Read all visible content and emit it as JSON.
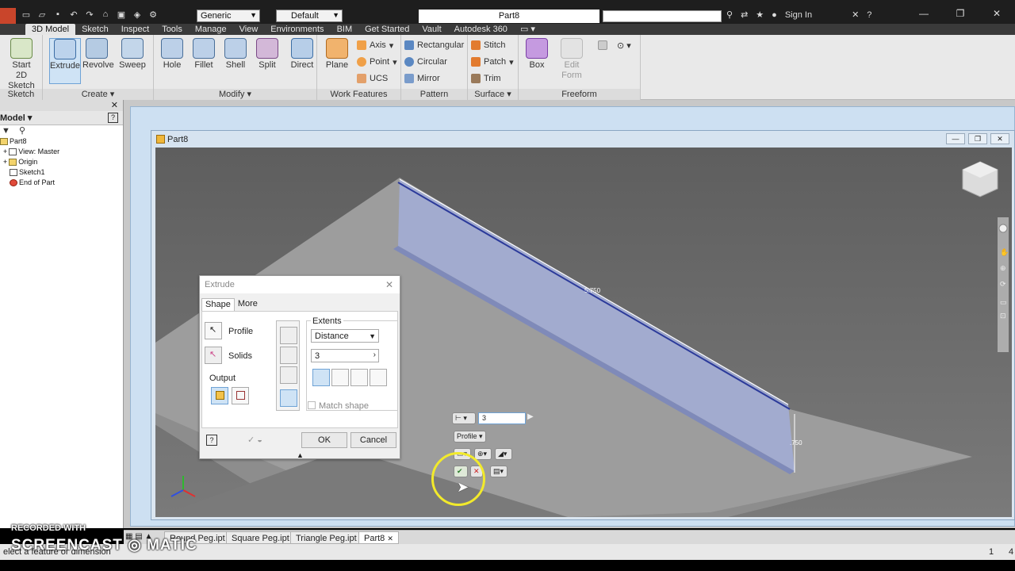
{
  "titlebar": {
    "material": "Generic",
    "appearance": "Default",
    "document_title": "Part8",
    "sign_in": "Sign In"
  },
  "ribbon_tabs": [
    "3D Model",
    "Sketch",
    "Inspect",
    "Tools",
    "Manage",
    "View",
    "Environments",
    "BIM",
    "Get Started",
    "Vault",
    "Autodesk 360"
  ],
  "ribbon": {
    "sketch": {
      "label": "Sketch",
      "start_line1": "Start",
      "start_line2": "2D Sketch"
    },
    "create": {
      "label": "Create",
      "extrude": "Extrude",
      "revolve": "Revolve",
      "sweep": "Sweep"
    },
    "modify": {
      "label": "Modify",
      "hole": "Hole",
      "fillet": "Fillet",
      "shell": "Shell",
      "split": "Split",
      "direct": "Direct"
    },
    "work_features": {
      "label": "Work Features",
      "plane": "Plane",
      "axis": "Axis",
      "point": "Point",
      "ucs": "UCS"
    },
    "pattern": {
      "label": "Pattern",
      "rectangular": "Rectangular",
      "circular": "Circular",
      "mirror": "Mirror"
    },
    "surface": {
      "label": "Surface",
      "stitch": "Stitch",
      "patch": "Patch",
      "trim": "Trim"
    },
    "freeform": {
      "label": "Freeform",
      "box": "Box",
      "edit_line1": "Edit",
      "edit_line2": "Form"
    }
  },
  "browser": {
    "title": "Model",
    "items": [
      "Part8",
      "View: Master",
      "Origin",
      "Sketch1",
      "End of Part"
    ]
  },
  "document": {
    "caption": "Part8"
  },
  "viewport": {
    "dim_length": "5.750",
    "dim_height": ".750"
  },
  "extrude_dialog": {
    "title": "Extrude",
    "tab_shape": "Shape",
    "tab_more": "More",
    "profile": "Profile",
    "solids": "Solids",
    "output": "Output",
    "extents": "Extents",
    "extents_type": "Distance",
    "distance_value": "3",
    "match_shape": "Match shape",
    "ok": "OK",
    "cancel": "Cancel"
  },
  "minitoolbar": {
    "value": "3",
    "profile": "Profile"
  },
  "doc_tabs": [
    "Round Peg.ipt",
    "Square Peg.ipt",
    "Triangle Peg.ipt",
    "Part8"
  ],
  "status": {
    "message": "elect a feature or dimension",
    "page1": "1",
    "page2": "4"
  },
  "watermark": {
    "line1": "RECORDED WITH",
    "line2": "SCREENCAST",
    "line3": "MATIC"
  },
  "colors": {
    "ribbon_bg": "#e9e9e9",
    "viewport_bg": "#6a6a6a",
    "accent": "#6fa3d6",
    "preview": "#9aa6d8",
    "highlight_ring": "#f2ea2b"
  }
}
